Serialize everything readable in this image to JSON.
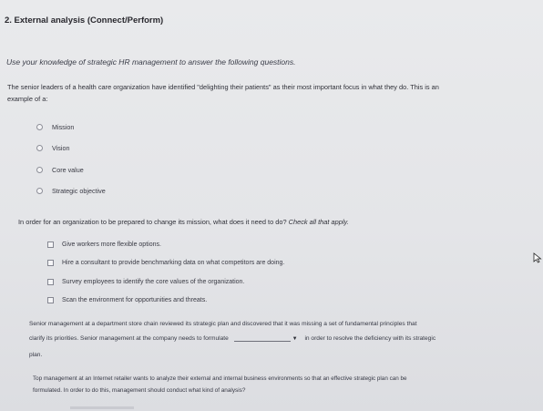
{
  "title": "2. External analysis (Connect/Perform)",
  "instructions": "Use your knowledge of strategic HR management to answer the following questions.",
  "q1": {
    "line1": "The senior leaders of a health care organization have identified \"delighting their patients\" as their most important focus in what they do. This is an",
    "line2": "example of a:",
    "options": [
      "Mission",
      "Vision",
      "Core value",
      "Strategic objective"
    ]
  },
  "q2": {
    "prompt": "In order for an organization to be prepared to change its mission, what does it need to do?",
    "prompt_italic": "Check all that apply.",
    "options": [
      "Give workers more flexible options.",
      "Hire a consultant to provide benchmarking data on what competitors are doing.",
      "Survey employees to identify the core values of the organization.",
      "Scan the environment for opportunities and threats."
    ]
  },
  "q3": {
    "line1": "Senior management at a department store chain reviewed its strategic plan and discovered that it was missing a set of fundamental principles that",
    "line2a": "clarify its priorities. Senior management at the company needs to formulate",
    "line2b": "in order to resolve the deficiency with its strategic",
    "line3": "plan."
  },
  "q4": {
    "line1": "Top management at an Internet retailer wants to analyze their external and internal business environments so that an effective strategic plan can be",
    "line2": "formulated. In order to do this, management should conduct what kind of analysis?"
  }
}
